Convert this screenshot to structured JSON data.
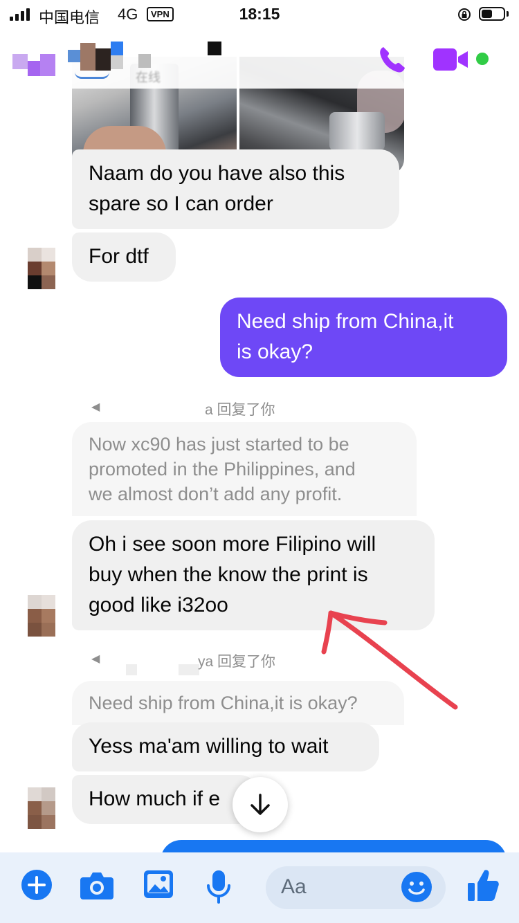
{
  "status_bar": {
    "carrier": "中国电信",
    "network": "4G",
    "vpn": "VPN",
    "time": "18:15",
    "battery_level": 0.5
  },
  "header": {
    "subtitle": "在线",
    "icons": {
      "call": "phone-icon",
      "video": "video-camera-icon",
      "online": "green-dot"
    },
    "accent_color": "#a033ff"
  },
  "messages": [
    {
      "id": "photos",
      "direction": "incoming",
      "type": "images",
      "count": 2
    },
    {
      "id": "m1",
      "direction": "incoming",
      "lines": [
        "Naam do you have also this",
        "spare so I can order"
      ]
    },
    {
      "id": "m2",
      "direction": "incoming",
      "text": "For dtf"
    },
    {
      "id": "m3",
      "direction": "outgoing",
      "lines": [
        "Need ship from China,it",
        "is okay?"
      ]
    },
    {
      "id": "r1",
      "type": "reply",
      "label": "a 回复了你",
      "quote_lines": [
        "Now xc90 has just started to be",
        "promoted in the Philippines, and",
        "we almost don’t add any profit."
      ]
    },
    {
      "id": "m4",
      "direction": "incoming",
      "lines": [
        "Oh i see soon more Filipino will",
        "buy when the know the print is",
        "good like i32oo"
      ]
    },
    {
      "id": "r2",
      "type": "reply",
      "label": "ya 回复了你",
      "quote": "Need ship from China,it is okay?"
    },
    {
      "id": "m5",
      "direction": "incoming",
      "text": "Yess ma'am willing to wait"
    },
    {
      "id": "m6",
      "direction": "incoming",
      "text": "How much if e"
    }
  ],
  "composer": {
    "placeholder": "Aa",
    "icons": [
      "plus-icon",
      "camera-icon",
      "gallery-icon",
      "microphone-icon",
      "emoji-icon",
      "thumbs-up-icon"
    ],
    "accent_color": "#1877f2"
  },
  "colors": {
    "outgoing_bubble": "#6e48f6",
    "incoming_bubble": "#f0f0f0",
    "annotation_arrow": "#e8424f"
  }
}
